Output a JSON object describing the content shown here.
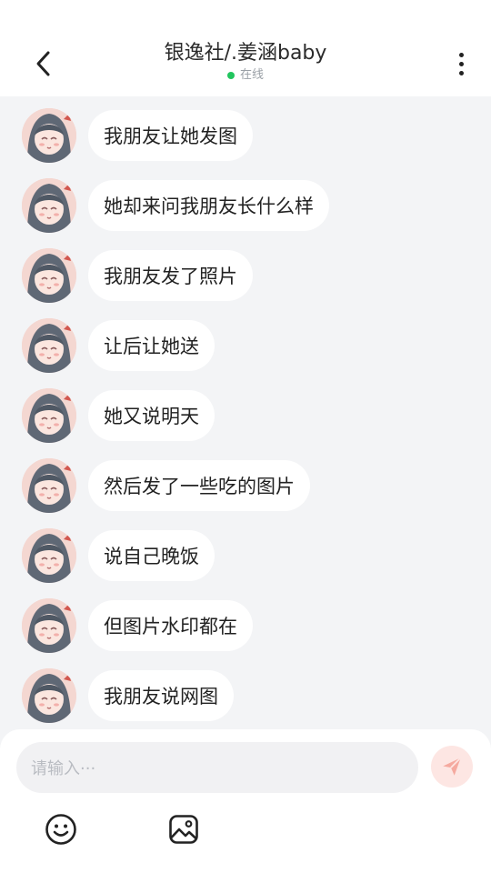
{
  "header": {
    "title": "银逸社/.姜涵baby",
    "status": "在线"
  },
  "messages": [
    {
      "text": "我朋友让她发图"
    },
    {
      "text": "她却来问我朋友长什么样"
    },
    {
      "text": "我朋友发了照片"
    },
    {
      "text": "让后让她送"
    },
    {
      "text": "她又说明天"
    },
    {
      "text": "然后发了一些吃的图片"
    },
    {
      "text": "说自己晚饭"
    },
    {
      "text": "但图片水印都在"
    },
    {
      "text": "我朋友说网图"
    }
  ],
  "composer": {
    "placeholder": "请输入···"
  },
  "colors": {
    "online": "#22c55e",
    "send": "#f5a99f",
    "background": "#f3f4f6"
  },
  "icons": [
    "back-arrow-icon",
    "more-vertical-icon",
    "send-icon",
    "emoji-icon",
    "image-icon"
  ]
}
